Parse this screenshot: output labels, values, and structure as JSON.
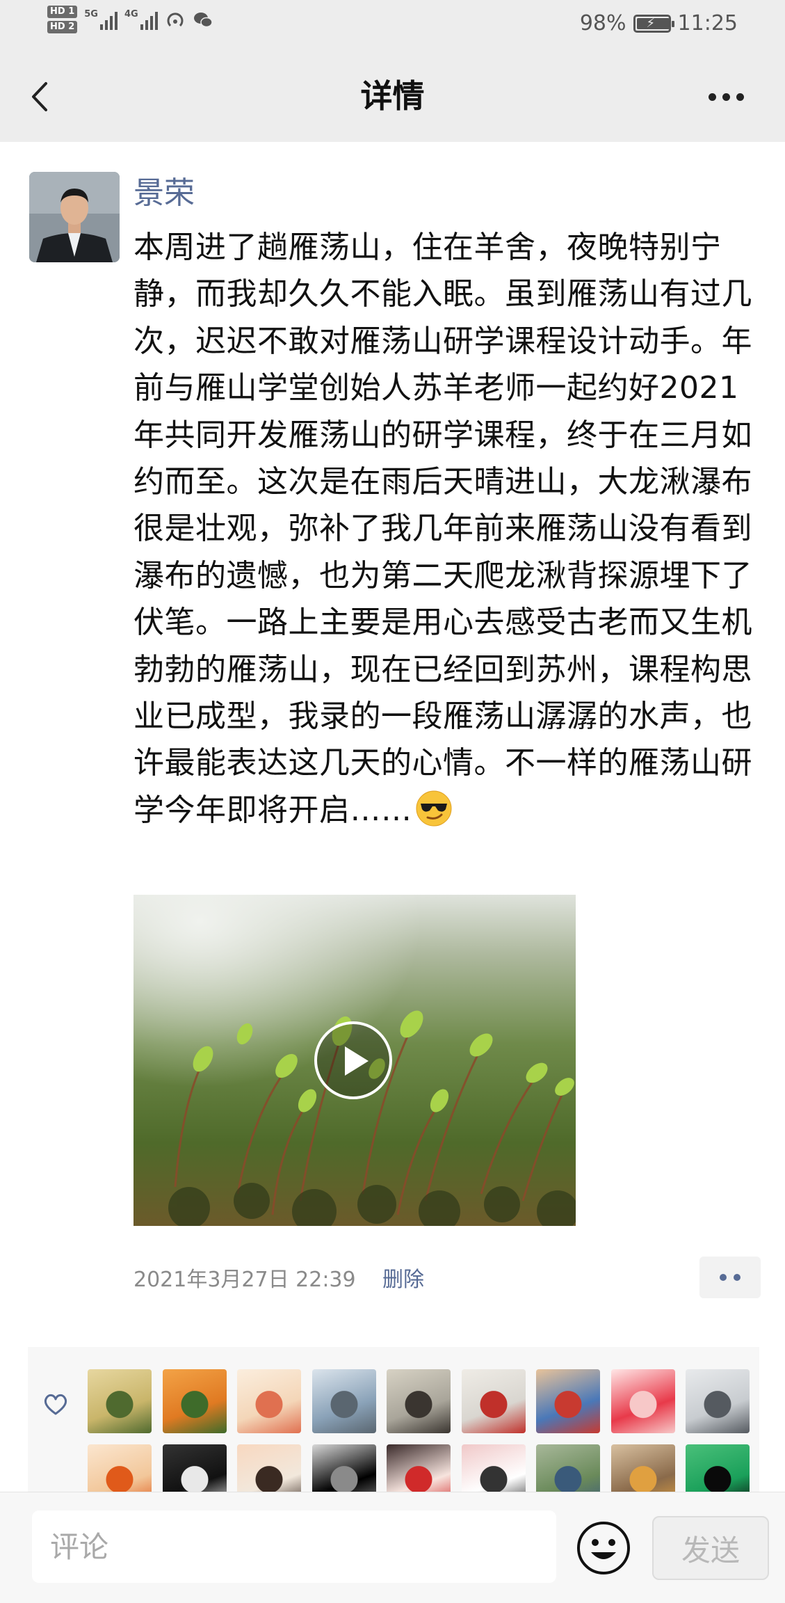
{
  "status_bar": {
    "sim1": "HD 1",
    "sim2": "HD 2",
    "net1": "5G",
    "net2": "4G",
    "battery_text": "98%",
    "battery_level": 0.98,
    "time": "11:25",
    "icons": [
      "hotspot-icon",
      "wechat-icon"
    ]
  },
  "nav": {
    "title": "详情",
    "icons": [
      "back-arrow-icon",
      "more-icon"
    ]
  },
  "post": {
    "author": "景荣",
    "text": "本周进了趟雁荡山，住在羊舍，夜晚特别宁静，而我却久久不能入眠。虽到雁荡山有过几次，迟迟不敢对雁荡山研学课程设计动手。年前与雁山学堂创始人苏羊老师一起约好2021年共同开发雁荡山的研学课程，终于在三月如约而至。这次是在雨后天晴进山，大龙湫瀑布很是壮观，弥补了我几年前来雁荡山没有看到瀑布的遗憾，也为第二天爬龙湫背探源埋下了伏笔。一路上主要是用心去感受古老而又生机勃勃的雁荡山，现在已经回到苏州，课程构思业已成型，我录的一段雁荡山潺潺的水声，也许最能表达这几天的心情。不一样的雁荡山研学今年即将开启……",
    "emoji": "sunglasses-emoji",
    "media": "video",
    "time": "2021年3月27日 22:39",
    "delete_label": "删除"
  },
  "likes": {
    "icon": "heart-icon",
    "row1": [
      {
        "name": "liker-avatar-1",
        "colors": [
          "#c9b56a",
          "#4f6a2f",
          "#e7d7a0"
        ]
      },
      {
        "name": "liker-avatar-2",
        "colors": [
          "#e07a22",
          "#3e6b2a",
          "#f3a347"
        ]
      },
      {
        "name": "liker-avatar-3",
        "colors": [
          "#f4d6b8",
          "#e07050",
          "#fbeede"
        ]
      },
      {
        "name": "liker-avatar-4",
        "colors": [
          "#8aa2b8",
          "#5a6670",
          "#dbe4ec"
        ]
      },
      {
        "name": "liker-avatar-5",
        "colors": [
          "#a9a59a",
          "#3a3530",
          "#d7d2c4"
        ]
      },
      {
        "name": "liker-avatar-6",
        "colors": [
          "#d9d6d0",
          "#c0302a",
          "#efece6"
        ]
      },
      {
        "name": "liker-avatar-7",
        "colors": [
          "#4a78b8",
          "#c83a30",
          "#e8c39a"
        ]
      },
      {
        "name": "liker-avatar-8",
        "colors": [
          "#e83a4a",
          "#f7c8c8",
          "#ffe6e6"
        ]
      },
      {
        "name": "liker-avatar-9",
        "colors": [
          "#c8ccd0",
          "#555a60",
          "#e8eaec"
        ]
      }
    ],
    "row2": [
      {
        "name": "liker-avatar-10",
        "colors": [
          "#f2c79a",
          "#e05a1a",
          "#fbe6cf"
        ]
      },
      {
        "name": "liker-avatar-11",
        "colors": [
          "#111111",
          "#e8e8e8",
          "#333333"
        ]
      },
      {
        "name": "liker-avatar-12",
        "colors": [
          "#f2e8dc",
          "#3a2a22",
          "#f8d8c0"
        ]
      },
      {
        "name": "liker-avatar-13",
        "colors": [
          "#000000",
          "#8a8a8a",
          "#d8d8d8"
        ]
      },
      {
        "name": "liker-avatar-14",
        "colors": [
          "#f7e4de",
          "#d02a2a",
          "#3a2a2a"
        ]
      },
      {
        "name": "liker-avatar-15",
        "colors": [
          "#ffffff",
          "#333333",
          "#f0c8c8"
        ]
      },
      {
        "name": "liker-avatar-16",
        "colors": [
          "#6a8a5a",
          "#3a5a7a",
          "#a8b89a"
        ]
      },
      {
        "name": "liker-avatar-17",
        "colors": [
          "#8a6a4a",
          "#e0a040",
          "#d8c0a0"
        ]
      },
      {
        "name": "liker-avatar-18",
        "colors": [
          "#1aa05a",
          "#0a0a0a",
          "#4ac07a"
        ]
      }
    ]
  },
  "comment_bar": {
    "placeholder": "评论",
    "emoji_icon": "smiley-icon",
    "send_label": "发送"
  },
  "colors": {
    "link": "#576b95",
    "nav_bg": "#ededed",
    "meta": "#8a8a8a"
  }
}
